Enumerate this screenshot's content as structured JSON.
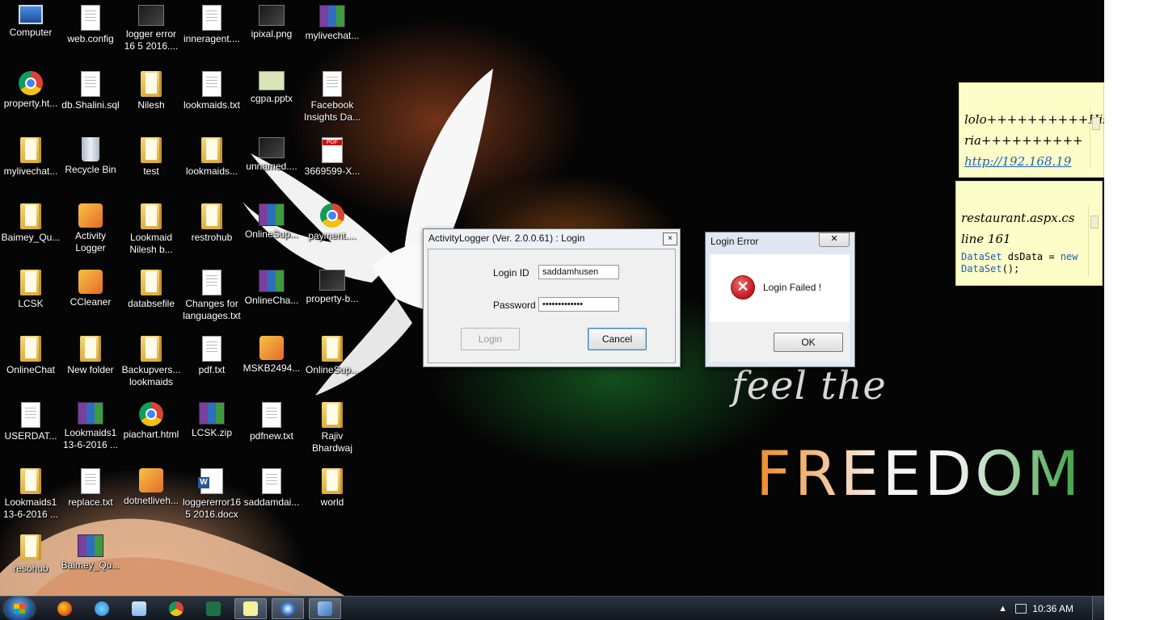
{
  "desktop": {
    "icons": [
      {
        "label": "Computer",
        "icon": "computer-icon",
        "kind": "monitor"
      },
      {
        "label": "web.config",
        "icon": "config-file-icon",
        "kind": "doc"
      },
      {
        "label": "logger error 16 5 2016....",
        "icon": "image-file-icon",
        "kind": "img"
      },
      {
        "label": "inneragent....",
        "icon": "spreadsheet-file-icon",
        "kind": "doc"
      },
      {
        "label": "ipixal.png",
        "icon": "image-file-icon",
        "kind": "img"
      },
      {
        "label": "mylivechat...",
        "icon": "winrar-archive-icon",
        "kind": "rar"
      },
      {
        "label": "property.ht...",
        "icon": "chrome-html-icon",
        "kind": "chrome"
      },
      {
        "label": "db.Shalini.sql",
        "icon": "sql-file-icon",
        "kind": "doc"
      },
      {
        "label": "Nilesh",
        "icon": "folder-icon",
        "kind": "folder"
      },
      {
        "label": "lookmaids.txt",
        "icon": "text-file-icon",
        "kind": "doc"
      },
      {
        "label": "cgpa.pptx",
        "icon": "powerpoint-file-icon",
        "kind": "ppt"
      },
      {
        "label": "Facebook Insights Da...",
        "icon": "document-file-icon",
        "kind": "doc"
      },
      {
        "label": "mylivechat...",
        "icon": "folder-icon",
        "kind": "folder"
      },
      {
        "label": "Recycle Bin",
        "icon": "recycle-bin-icon",
        "kind": "bin"
      },
      {
        "label": "test",
        "icon": "folder-icon",
        "kind": "folder"
      },
      {
        "label": "lookmaids...",
        "icon": "folder-icon",
        "kind": "folder"
      },
      {
        "label": "unnamed....",
        "icon": "image-file-icon",
        "kind": "img"
      },
      {
        "label": "3669599-X...",
        "icon": "pdf-file-icon",
        "kind": "pdf"
      },
      {
        "label": "Baimey_Qu...",
        "icon": "folder-icon",
        "kind": "folder"
      },
      {
        "label": "Activity Logger",
        "icon": "activity-logger-app-icon",
        "kind": "app"
      },
      {
        "label": "Lookmaid Nilesh b...",
        "icon": "folder-icon",
        "kind": "folder"
      },
      {
        "label": "restrohub",
        "icon": "folder-icon",
        "kind": "folder"
      },
      {
        "label": "OnlineSup...",
        "icon": "winrar-archive-icon",
        "kind": "rar"
      },
      {
        "label": "payment....",
        "icon": "chrome-html-icon",
        "kind": "chrome"
      },
      {
        "label": "LCSK",
        "icon": "folder-icon",
        "kind": "folder"
      },
      {
        "label": "CCleaner",
        "icon": "ccleaner-icon",
        "kind": "app"
      },
      {
        "label": "databsefile",
        "icon": "folder-icon",
        "kind": "folder"
      },
      {
        "label": "Changes for languages.txt",
        "icon": "text-file-icon",
        "kind": "doc"
      },
      {
        "label": "OnlineCha...",
        "icon": "winrar-archive-icon",
        "kind": "rar"
      },
      {
        "label": "property-b...",
        "icon": "web-image-icon",
        "kind": "img"
      },
      {
        "label": "OnlineChat",
        "icon": "folder-icon",
        "kind": "folder"
      },
      {
        "label": "New folder",
        "icon": "folder-icon",
        "kind": "folder"
      },
      {
        "label": "Backupvers... lookmaids",
        "icon": "folder-icon",
        "kind": "folder"
      },
      {
        "label": "pdf.txt",
        "icon": "text-file-icon",
        "kind": "doc"
      },
      {
        "label": "MSKB2494...",
        "icon": "installer-icon",
        "kind": "app"
      },
      {
        "label": "OnlineSup...",
        "icon": "folder-icon",
        "kind": "folder"
      },
      {
        "label": "USERDAT...",
        "icon": "document-file-icon",
        "kind": "doc"
      },
      {
        "label": "Lookmaids1 13-6-2016 ...",
        "icon": "winrar-archive-icon",
        "kind": "rar"
      },
      {
        "label": "piachart.html",
        "icon": "chrome-html-icon",
        "kind": "chrome"
      },
      {
        "label": "LCSK.zip",
        "icon": "winrar-archive-icon",
        "kind": "rar"
      },
      {
        "label": "pdfnew.txt",
        "icon": "text-file-icon",
        "kind": "doc"
      },
      {
        "label": "Rajiv Bhardwaj",
        "icon": "folder-icon",
        "kind": "folder"
      },
      {
        "label": "Lookmaids1 13-6-2016 ...",
        "icon": "folder-icon",
        "kind": "folder"
      },
      {
        "label": "replace.txt",
        "icon": "text-file-icon",
        "kind": "doc"
      },
      {
        "label": "dotnetliveh...",
        "icon": "installer-icon",
        "kind": "app"
      },
      {
        "label": "loggererror16 5 2016.docx",
        "icon": "word-document-icon",
        "kind": "word"
      },
      {
        "label": "saddamdai...",
        "icon": "document-file-icon",
        "kind": "doc"
      },
      {
        "label": "world",
        "icon": "folder-icon",
        "kind": "folder"
      },
      {
        "label": "resohub",
        "icon": "folder-icon",
        "kind": "folder"
      },
      {
        "label": "Baimey_Qu...",
        "icon": "winrar-archive-icon",
        "kind": "rar"
      }
    ]
  },
  "wallpaper": {
    "line1": "feel the",
    "line2": "FREEDOM",
    "accent_orange": "#f08a2a",
    "accent_green": "#3aa040"
  },
  "sticky_notes": [
    {
      "line1": "lolo++++++++++Hisu",
      "line2": "ria++++++++++",
      "link": "http://192.168.19"
    },
    {
      "line1": "restaurant.aspx.cs",
      "line2": "line 161",
      "code_a": "DataSet",
      "code_b": " dsData = ",
      "code_c": "new",
      "code_d": "DataSet",
      "code_e": "();"
    }
  ],
  "login_window": {
    "title": "ActivityLogger (Ver. 2.0.0.61) : Login",
    "close": "×",
    "login_id_label": "Login ID",
    "login_id_value": "saddamhusen",
    "password_label": "Password",
    "password_value": "•••••••••••••",
    "login_button": "Login",
    "cancel_button": "Cancel"
  },
  "error_dialog": {
    "title": "Login Error",
    "close": "✕",
    "message": "Login Failed !",
    "ok_button": "OK",
    "error_color": "#c0161d"
  },
  "taskbar": {
    "clock": "10:36 AM",
    "tray_arrow": "▲"
  }
}
